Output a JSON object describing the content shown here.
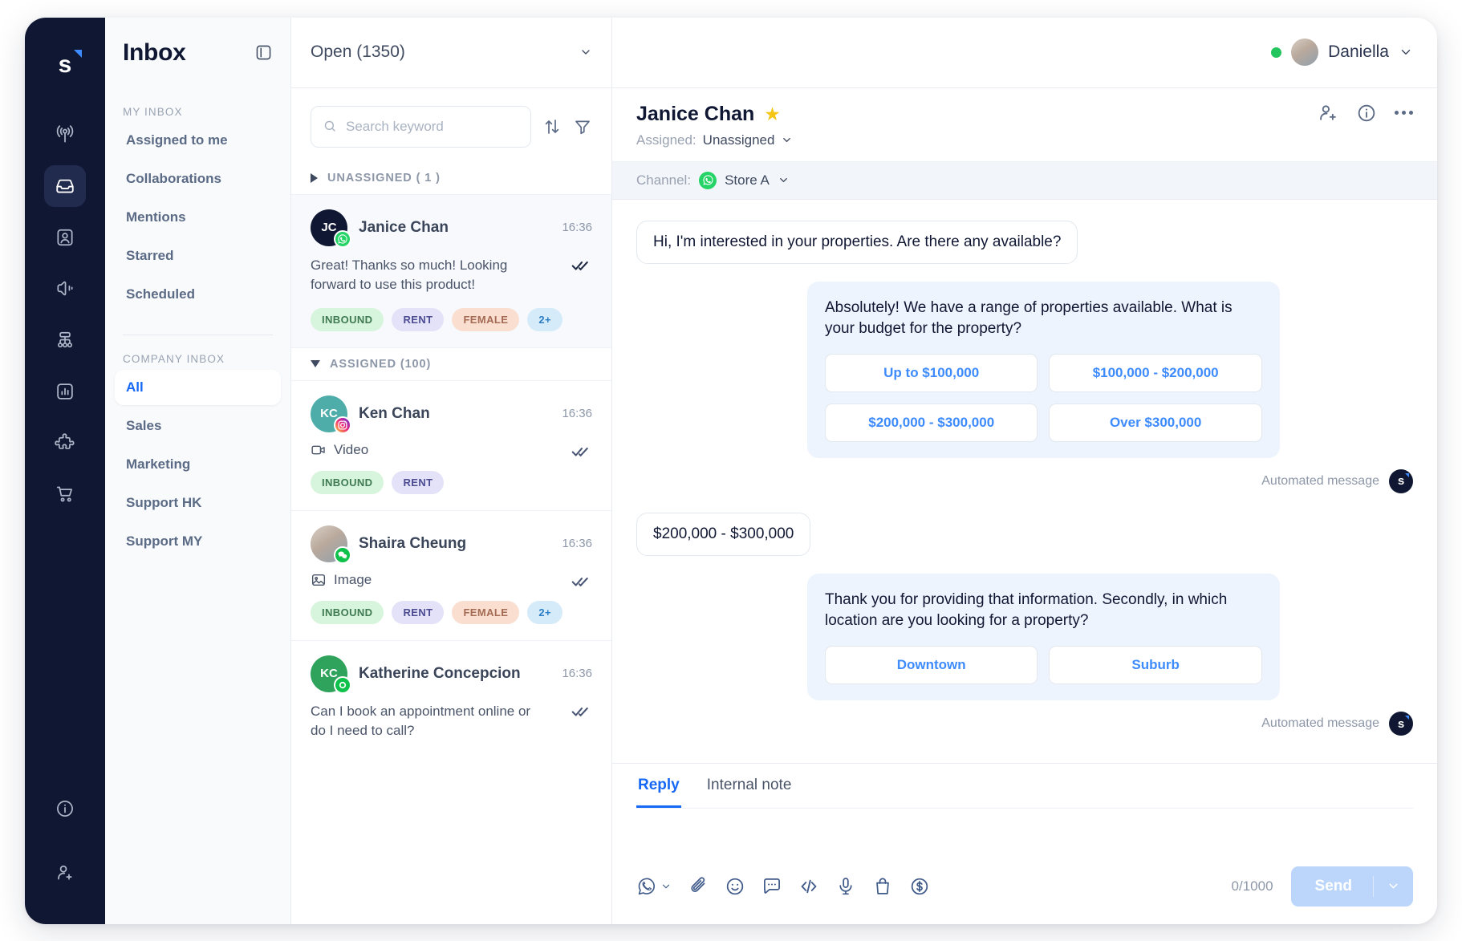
{
  "rail": {
    "logo_letter": "s",
    "items": [
      {
        "name": "broadcast-icon",
        "label": "Broadcast"
      },
      {
        "name": "inbox-icon",
        "label": "Inbox",
        "active": true
      },
      {
        "name": "contacts-icon",
        "label": "Contacts"
      },
      {
        "name": "campaign-icon",
        "label": "Campaign"
      },
      {
        "name": "flow-builder-icon",
        "label": "Flow Builder"
      },
      {
        "name": "analytics-icon",
        "label": "Analytics"
      },
      {
        "name": "integrations-icon",
        "label": "Integrations"
      },
      {
        "name": "commerce-icon",
        "label": "Commerce"
      }
    ],
    "bottom_items": [
      {
        "name": "info-icon",
        "label": "Info"
      },
      {
        "name": "invite-user-icon",
        "label": "Invite user"
      }
    ]
  },
  "sidebar": {
    "title": "Inbox",
    "panel_toggle": "panel-toggle-icon",
    "my_inbox_label": "MY INBOX",
    "my_inbox_items": [
      {
        "label": "Assigned to me"
      },
      {
        "label": "Collaborations"
      },
      {
        "label": "Mentions"
      },
      {
        "label": "Starred"
      },
      {
        "label": "Scheduled"
      }
    ],
    "company_inbox_label": "COMPANY INBOX",
    "company_inbox_items": [
      {
        "label": "All",
        "active": true
      },
      {
        "label": "Sales"
      },
      {
        "label": "Marketing"
      },
      {
        "label": "Support HK"
      },
      {
        "label": "Support MY"
      }
    ]
  },
  "conversation_list": {
    "status_filter": "Open (1350)",
    "search_placeholder": "Search keyword",
    "search_value": "",
    "sort_icon": "sort-icon",
    "filter_icon": "filter-icon",
    "sections": [
      {
        "title": "UNASSIGNED ( 1 )",
        "collapsed": true,
        "items": [
          {
            "initials": "JC",
            "avatar_color": "#101733",
            "name": "Janice Chan",
            "time": "16:36",
            "preview": "Great! Thanks so much! Looking forward to use this product!",
            "preview_type": "text",
            "channel": "whatsapp",
            "selected": true,
            "tags": [
              {
                "label": "INBOUND",
                "style": "inbound"
              },
              {
                "label": "RENT",
                "style": "rent"
              },
              {
                "label": "FEMALE",
                "style": "female"
              },
              {
                "label": "2+",
                "style": "more"
              }
            ]
          }
        ]
      },
      {
        "title": "ASSIGNED (100)",
        "collapsed": false,
        "items": [
          {
            "initials": "KC",
            "avatar_color": "#4fada9",
            "name": "Ken Chan",
            "time": "16:36",
            "preview": "Video",
            "preview_type": "video",
            "channel": "instagram",
            "selected": false,
            "tags": [
              {
                "label": "INBOUND",
                "style": "inbound"
              },
              {
                "label": "RENT",
                "style": "rent"
              }
            ]
          },
          {
            "initials": "",
            "avatar_color": "photo",
            "name": "Shaira Cheung",
            "time": "16:36",
            "preview": "Image",
            "preview_type": "image",
            "channel": "wechat",
            "selected": false,
            "tags": [
              {
                "label": "INBOUND",
                "style": "inbound"
              },
              {
                "label": "RENT",
                "style": "rent"
              },
              {
                "label": "FEMALE",
                "style": "female"
              },
              {
                "label": "2+",
                "style": "more"
              }
            ]
          },
          {
            "initials": "KC",
            "avatar_color": "#2fa35c",
            "name": "Katherine Concepcion",
            "time": "16:36",
            "preview": "Can I book an appointment online or do I need to call?",
            "preview_type": "text",
            "channel": "whatsapp-ring",
            "selected": false,
            "tags": []
          }
        ]
      }
    ]
  },
  "topbar": {
    "user_name": "Daniella",
    "status": "online",
    "chevron": "chevron-down-icon"
  },
  "conversation": {
    "contact_name": "Janice Chan",
    "starred": true,
    "assigned_label": "Assigned:",
    "assigned_value": "Unassigned",
    "channel_label": "Channel:",
    "channel_value": "Store A",
    "actions": [
      {
        "name": "add-contact-icon"
      },
      {
        "name": "info-icon"
      },
      {
        "name": "more-options-icon"
      }
    ],
    "messages": [
      {
        "direction": "in",
        "text": "Hi, I'm interested in your properties. Are there any available?"
      },
      {
        "direction": "out",
        "text": "Absolutely! We have a range of properties available. What is your budget for the property?",
        "quick_replies": [
          "Up to $100,000",
          "$100,000 - $200,000",
          "$200,000 - $300,000",
          "Over $300,000"
        ],
        "footer": "Automated message"
      },
      {
        "direction": "in",
        "text": "$200,000 - $300,000"
      },
      {
        "direction": "out",
        "text": "Thank you for providing that information. Secondly, in which location are you looking for a property?",
        "quick_replies": [
          "Downtown",
          "Suburb"
        ],
        "footer": "Automated message"
      }
    ]
  },
  "composer": {
    "tabs": [
      {
        "label": "Reply",
        "active": true
      },
      {
        "label": "Internal note",
        "active": false
      }
    ],
    "input_value": "",
    "counter": "0/1000",
    "send_label": "Send",
    "tools": [
      {
        "name": "whatsapp-channel-icon"
      },
      {
        "name": "attachment-icon"
      },
      {
        "name": "emoji-icon"
      },
      {
        "name": "quick-reply-icon"
      },
      {
        "name": "code-snippet-icon"
      },
      {
        "name": "voice-message-icon"
      },
      {
        "name": "product-bag-icon"
      },
      {
        "name": "payment-icon"
      }
    ]
  },
  "colors": {
    "accent": "#1668f5",
    "link": "#3d8bfd",
    "dark": "#101733",
    "online": "#22c55e",
    "star": "#f5c518"
  }
}
